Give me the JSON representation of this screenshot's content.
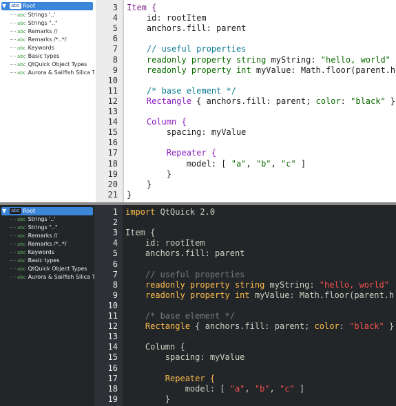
{
  "light": {
    "tree": {
      "root": {
        "label": "Root",
        "badge": "abc"
      },
      "items": [
        {
          "label": "Strings '..'"
        },
        {
          "label": "Strings \"..\""
        },
        {
          "label": "Remarks //"
        },
        {
          "label": "Remarks /*..*/"
        },
        {
          "label": "Keywords"
        },
        {
          "label": "Basic types"
        },
        {
          "label": "QtQuick Object Types"
        },
        {
          "label": "Aurora & Sailfish Silica T"
        }
      ]
    },
    "lines": [
      {
        "num": "3",
        "segs": [
          [
            "Item {",
            "kw"
          ]
        ]
      },
      {
        "num": "4",
        "segs": [
          [
            "    id: rootItem",
            ""
          ]
        ]
      },
      {
        "num": "5",
        "segs": [
          [
            "    anchors.fill: parent",
            ""
          ]
        ]
      },
      {
        "num": "6",
        "segs": [
          [
            "",
            ""
          ]
        ]
      },
      {
        "num": "7",
        "segs": [
          [
            "    // useful properties",
            "cmtline"
          ]
        ]
      },
      {
        "num": "8",
        "segs": [
          [
            "    readonly property string ",
            "str"
          ],
          [
            "myString: ",
            ""
          ],
          [
            "\"hello, world\"",
            "str"
          ]
        ]
      },
      {
        "num": "9",
        "segs": [
          [
            "    readonly property int ",
            "str"
          ],
          [
            "myValue: Math.floor(parent.he",
            ""
          ]
        ]
      },
      {
        "num": "10",
        "segs": [
          [
            "",
            ""
          ]
        ]
      },
      {
        "num": "11",
        "segs": [
          [
            "    /* base element */",
            "cmtline"
          ]
        ]
      },
      {
        "num": "12",
        "segs": [
          [
            "    Rectangle",
            "cm"
          ],
          [
            " { anchors.fill: parent; ",
            ""
          ],
          [
            "color",
            "str"
          ],
          [
            ": ",
            ""
          ],
          [
            "\"black\"",
            "str"
          ],
          [
            " }",
            ""
          ]
        ]
      },
      {
        "num": "13",
        "segs": [
          [
            "",
            ""
          ]
        ]
      },
      {
        "num": "14",
        "segs": [
          [
            "    Column {",
            "cm"
          ]
        ]
      },
      {
        "num": "15",
        "segs": [
          [
            "        spacing: myValue",
            ""
          ]
        ]
      },
      {
        "num": "16",
        "segs": [
          [
            "",
            ""
          ]
        ]
      },
      {
        "num": "17",
        "segs": [
          [
            "        Repeater {",
            "cm"
          ]
        ]
      },
      {
        "num": "18",
        "segs": [
          [
            "            model: [ ",
            ""
          ],
          [
            "\"a\"",
            "str"
          ],
          [
            ", ",
            ""
          ],
          [
            "\"b\"",
            "str"
          ],
          [
            ", ",
            ""
          ],
          [
            "\"c\"",
            "str"
          ],
          [
            " ]",
            ""
          ]
        ]
      },
      {
        "num": "19",
        "segs": [
          [
            "        }",
            ""
          ]
        ]
      },
      {
        "num": "20",
        "segs": [
          [
            "    }",
            ""
          ]
        ]
      },
      {
        "num": "21",
        "segs": [
          [
            "}",
            ""
          ]
        ]
      }
    ]
  },
  "dark": {
    "tree": {
      "root": {
        "label": "Root",
        "badge": "abc"
      },
      "items": [
        {
          "label": "Strings '..'"
        },
        {
          "label": "Strings \"..\""
        },
        {
          "label": "Remarks //"
        },
        {
          "label": "Remarks /*..*/"
        },
        {
          "label": "Keywords"
        },
        {
          "label": "Basic types"
        },
        {
          "label": "QtQuick Object Types"
        },
        {
          "label": "Aurora & Sailfish Silica T"
        }
      ]
    },
    "lines": [
      {
        "num": "1",
        "segs": [
          [
            "import ",
            "kw"
          ],
          [
            "QtQuick 2.0",
            ""
          ]
        ]
      },
      {
        "num": "2",
        "segs": [
          [
            "",
            ""
          ]
        ]
      },
      {
        "num": "3",
        "segs": [
          [
            "Item {",
            ""
          ]
        ]
      },
      {
        "num": "4",
        "segs": [
          [
            "    id: rootItem",
            ""
          ]
        ]
      },
      {
        "num": "5",
        "segs": [
          [
            "    anchors.fill: parent",
            ""
          ]
        ]
      },
      {
        "num": "6",
        "segs": [
          [
            "",
            ""
          ]
        ]
      },
      {
        "num": "7",
        "segs": [
          [
            "    // useful properties",
            "cmtline"
          ]
        ]
      },
      {
        "num": "8",
        "segs": [
          [
            "    readonly property string ",
            "kw"
          ],
          [
            "myString: ",
            ""
          ],
          [
            "\"hello, world\"",
            "str"
          ]
        ]
      },
      {
        "num": "9",
        "segs": [
          [
            "    readonly property int ",
            "kw"
          ],
          [
            "myValue: Math.floor(parent.h",
            ""
          ]
        ]
      },
      {
        "num": "10",
        "segs": [
          [
            "",
            ""
          ]
        ]
      },
      {
        "num": "11",
        "segs": [
          [
            "    /* base element */",
            "cmtline"
          ]
        ]
      },
      {
        "num": "12",
        "segs": [
          [
            "    Rectangle",
            "kw"
          ],
          [
            " { anchors.fill: parent; ",
            ""
          ],
          [
            "color",
            "kw"
          ],
          [
            ": ",
            ""
          ],
          [
            "\"black\"",
            "str"
          ],
          [
            " }",
            ""
          ]
        ]
      },
      {
        "num": "13",
        "segs": [
          [
            "",
            ""
          ]
        ]
      },
      {
        "num": "14",
        "segs": [
          [
            "    Column {",
            ""
          ]
        ]
      },
      {
        "num": "15",
        "segs": [
          [
            "        spacing: myValue",
            ""
          ]
        ]
      },
      {
        "num": "16",
        "segs": [
          [
            "",
            ""
          ]
        ]
      },
      {
        "num": "17",
        "segs": [
          [
            "        Repeater {",
            "kw"
          ]
        ]
      },
      {
        "num": "18",
        "segs": [
          [
            "            model: [ ",
            ""
          ],
          [
            "\"a\"",
            "str"
          ],
          [
            ", ",
            ""
          ],
          [
            "\"b\"",
            "str"
          ],
          [
            ", ",
            ""
          ],
          [
            "\"c\"",
            "str"
          ],
          [
            " ]",
            ""
          ]
        ]
      },
      {
        "num": "19",
        "segs": [
          [
            "        }",
            ""
          ]
        ]
      }
    ]
  }
}
